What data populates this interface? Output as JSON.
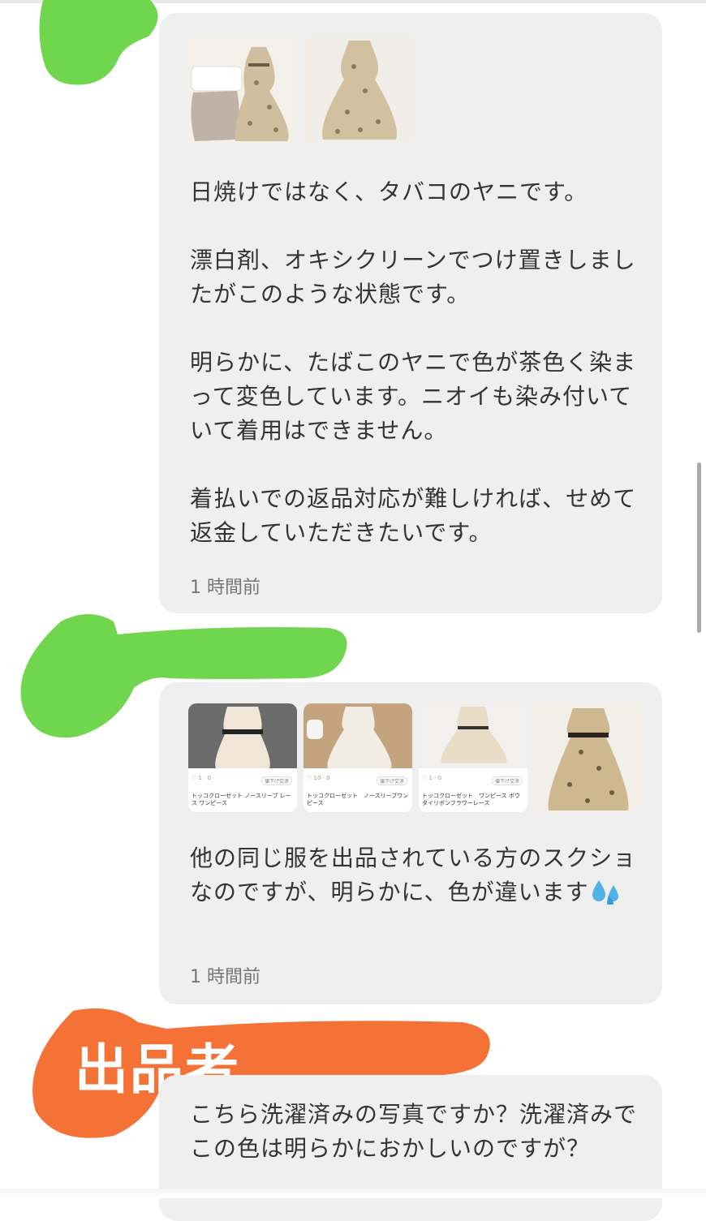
{
  "messages": [
    {
      "images": [
        "dress-with-bags-photo",
        "dress-photo"
      ],
      "text": "日焼けではなく、タバコのヤニです。\n\n漂白剤、オキシクリーンでつけ置きしましたがこのような状態です。\n\n明らかに、たばこのヤニで色が茶色く染まって変色しています。ニオイも染み付いていて着用はできません。\n\n着払いでの返品対応が難しければ、せめて返金していただきたいです。",
      "time": "1 時間前"
    },
    {
      "listings": [
        {
          "likes": "1",
          "comments": "0",
          "title": "トッコクローゼット ノースリーブ レース ワンピース",
          "tag": "値下げ交渉"
        },
        {
          "likes": "10",
          "comments": "0",
          "title": "トッコクローゼット　ノースリーブワンピース",
          "tag": "値下げ交渉"
        },
        {
          "likes": "1",
          "comments": "0",
          "title": "トッコクローゼット　ワンピース ボウタイリボンフラワーレース",
          "tag": "値下げ交渉"
        }
      ],
      "text_before_emoji": "他の同じ服を出品されている方のスクショなのですが、明らかに、色が違います",
      "emoji": "sweat-droplets-icon",
      "time": "1 時間前"
    },
    {
      "sender_label": "出品者",
      "text": "こちら洗濯済みの写真ですか？洗濯済みでこの色は明らかにおかしいのですが？"
    }
  ],
  "colors": {
    "bubble": "#efefef",
    "green_highlight": "#6fd64e",
    "orange_highlight": "#f57236",
    "text": "#343434",
    "time": "#757575"
  }
}
